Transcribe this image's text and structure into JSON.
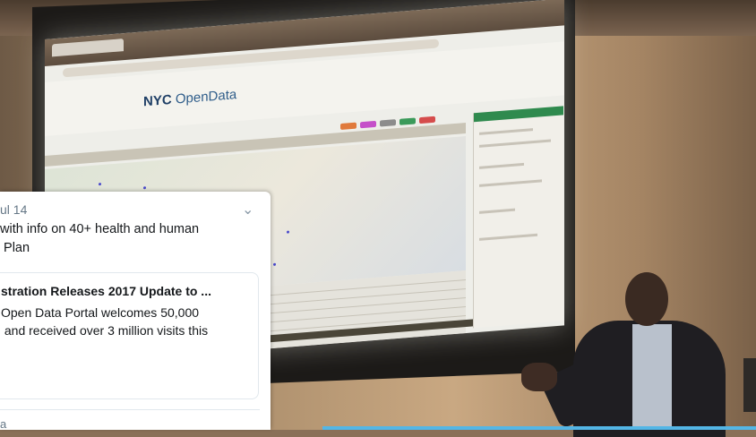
{
  "tweet": {
    "date": "ul 14",
    "text": "with info on 40+ health and human\n Plan",
    "card_title": "stration Releases 2017 Update to ...",
    "card_description": "Open Data Portal welcomes 50,000\n and received over 3 million visits this",
    "footer": "a",
    "chevron_icon": "chevron-down-icon"
  },
  "slide": {
    "logo_prefix": "NYC",
    "logo_name": "OpenData"
  },
  "colors": {
    "card_border": "#e1e8ed",
    "accent_green": "#2f8a4e",
    "map_dots": "#4a4acb"
  }
}
